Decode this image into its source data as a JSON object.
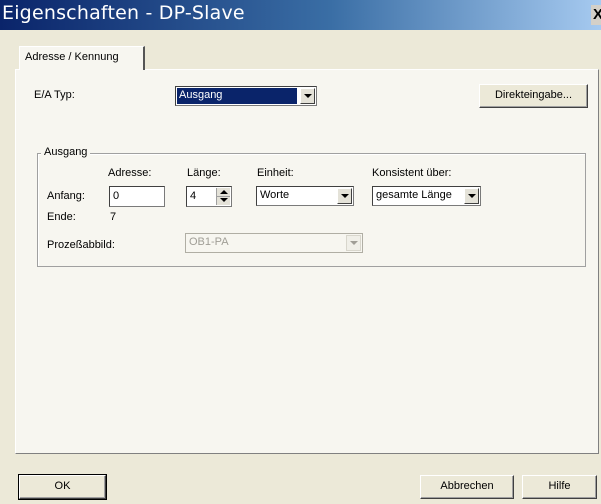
{
  "window": {
    "title": "Eigenschaften - DP-Slave",
    "close_glyph": "X"
  },
  "tabs": [
    {
      "label": "Adresse / Kennung"
    }
  ],
  "io_type": {
    "label": "E/A Typ:",
    "value": "Ausgang"
  },
  "direct_input_button": "Direkteingabe...",
  "group": {
    "title": "Ausgang",
    "headers": {
      "address": "Adresse:",
      "length": "Länge:",
      "unit": "Einheit:",
      "consistency": "Konsistent über:"
    },
    "start": {
      "label": "Anfang:",
      "address": "0",
      "length": "4",
      "unit": "Worte",
      "consistency": "gesamte Länge"
    },
    "end": {
      "label": "Ende:",
      "value": "7"
    },
    "process_image": {
      "label": "Prozeßabbild:",
      "value": "OB1-PA"
    }
  },
  "footer": {
    "ok": "OK",
    "cancel": "Abbrechen",
    "help": "Hilfe"
  },
  "colors": {
    "title_start": "#0a246a",
    "title_end": "#a6caf0",
    "selection": "#0a246a",
    "face": "#ece9d8"
  }
}
